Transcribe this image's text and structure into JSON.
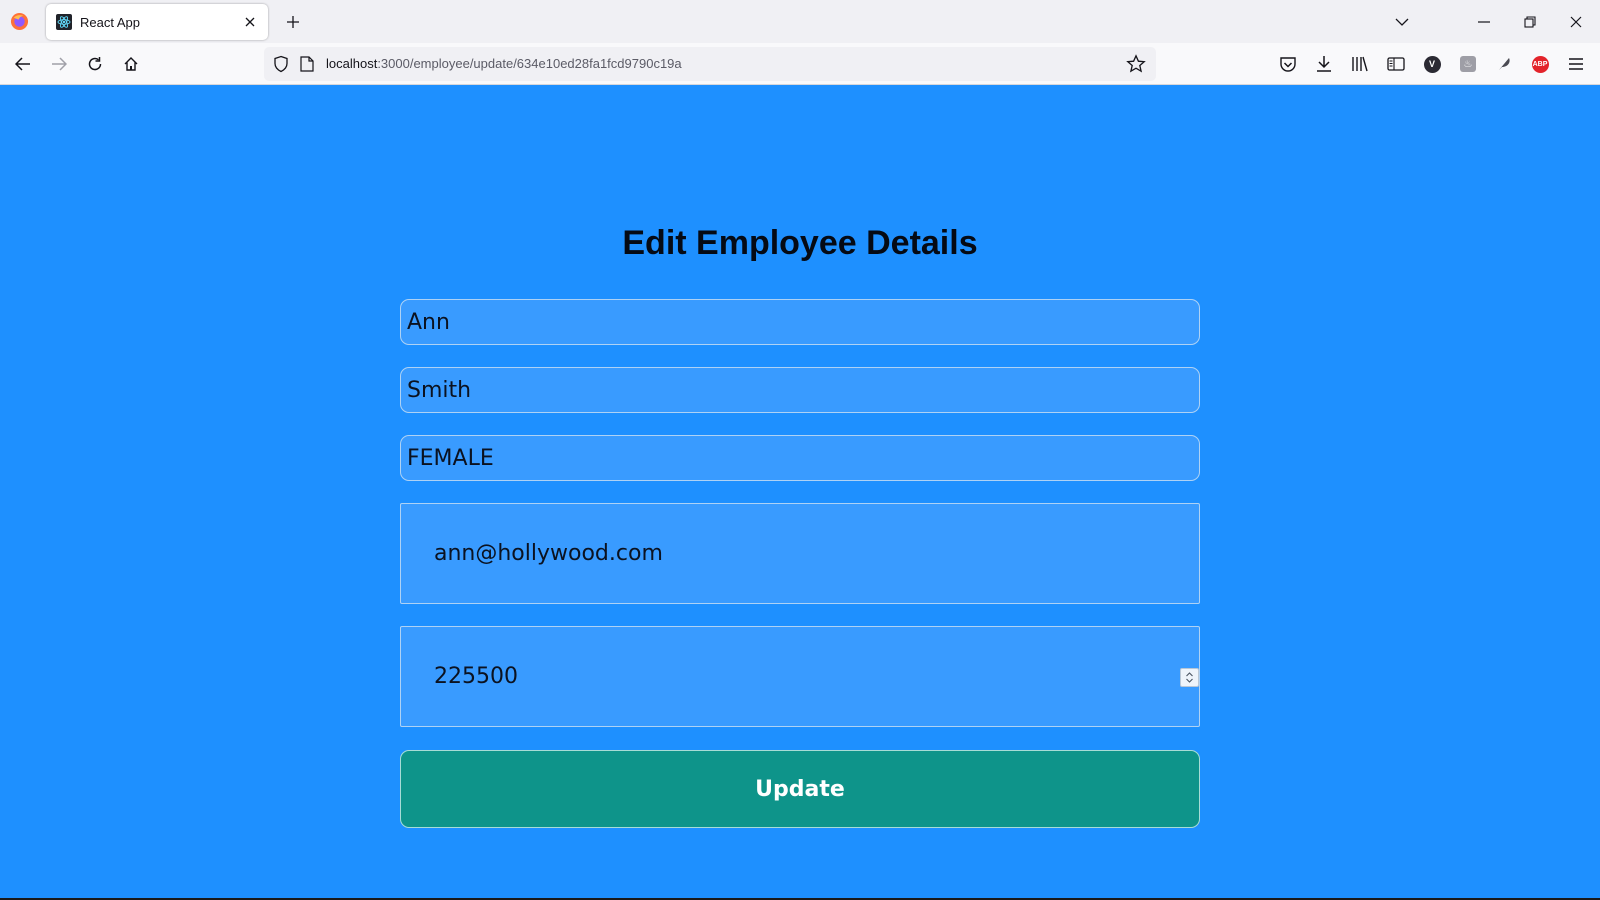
{
  "browser": {
    "tab": {
      "title": "React App"
    },
    "url": {
      "host": "localhost",
      "path": ":3000/employee/update/634e10ed28fa1fcd9790c19a"
    },
    "icons": {
      "firefox": "firefox-logo-icon",
      "extension_v": "V",
      "extension_abp": "ABP"
    }
  },
  "page": {
    "title": "Edit Employee Details",
    "form": {
      "first_name": "Ann",
      "last_name": "Smith",
      "gender": "FEMALE",
      "email": "ann@hollywood.com",
      "salary": "225500",
      "submit_label": "Update"
    }
  },
  "colors": {
    "background": "#1e90ff",
    "field": "#399bff",
    "button": "#0e948a"
  }
}
